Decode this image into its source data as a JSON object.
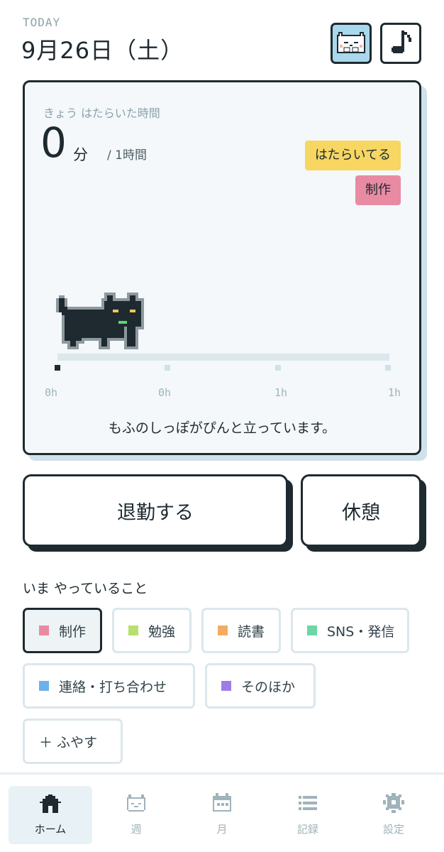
{
  "header": {
    "today_label": "TODAY",
    "date": "9月26日（土）",
    "cat_button_icon": "cat-face-icon",
    "music_button_icon": "music-note-icon"
  },
  "card": {
    "label": "きょう はたらいた時間",
    "minutes_value": "0",
    "minutes_unit": "分",
    "target": "/ 1時間",
    "status_badge": "はたらいてる",
    "task_badge": "制作",
    "progress_fraction": 0,
    "timeline_labels": [
      "0h",
      "0h",
      "1h",
      "1h"
    ],
    "message": "もふのしっぽがぴんと立っています。"
  },
  "actions": {
    "clockout_label": "退勤する",
    "break_label": "休憩"
  },
  "activity": {
    "title": "いま やっていること",
    "chips": [
      {
        "label": "制作",
        "color": "#e98aa3",
        "selected": true
      },
      {
        "label": "勉強",
        "color": "#b9df6c",
        "selected": false
      },
      {
        "label": "読書",
        "color": "#f2ad62",
        "selected": false
      },
      {
        "label": "SNS・発信",
        "color": "#6dd7a6",
        "selected": false
      },
      {
        "label": "連絡・打ち合わせ",
        "color": "#6db0ec",
        "selected": false
      },
      {
        "label": "そのほか",
        "color": "#9f7be8",
        "selected": false
      }
    ],
    "add_label": "＋ ふやす"
  },
  "tabs": [
    {
      "label": "ホーム",
      "icon": "home-icon",
      "active": true
    },
    {
      "label": "週",
      "icon": "cat-face-icon",
      "active": false
    },
    {
      "label": "月",
      "icon": "calendar-icon",
      "active": false
    },
    {
      "label": "記録",
      "icon": "list-icon",
      "active": false
    },
    {
      "label": "設定",
      "icon": "gear-icon",
      "active": false
    }
  ],
  "colors": {
    "ink": "#1e2a30",
    "status_yellow": "#f7d662",
    "task_pink": "#e98aa3",
    "accent_blue": "#a9d8ec"
  }
}
